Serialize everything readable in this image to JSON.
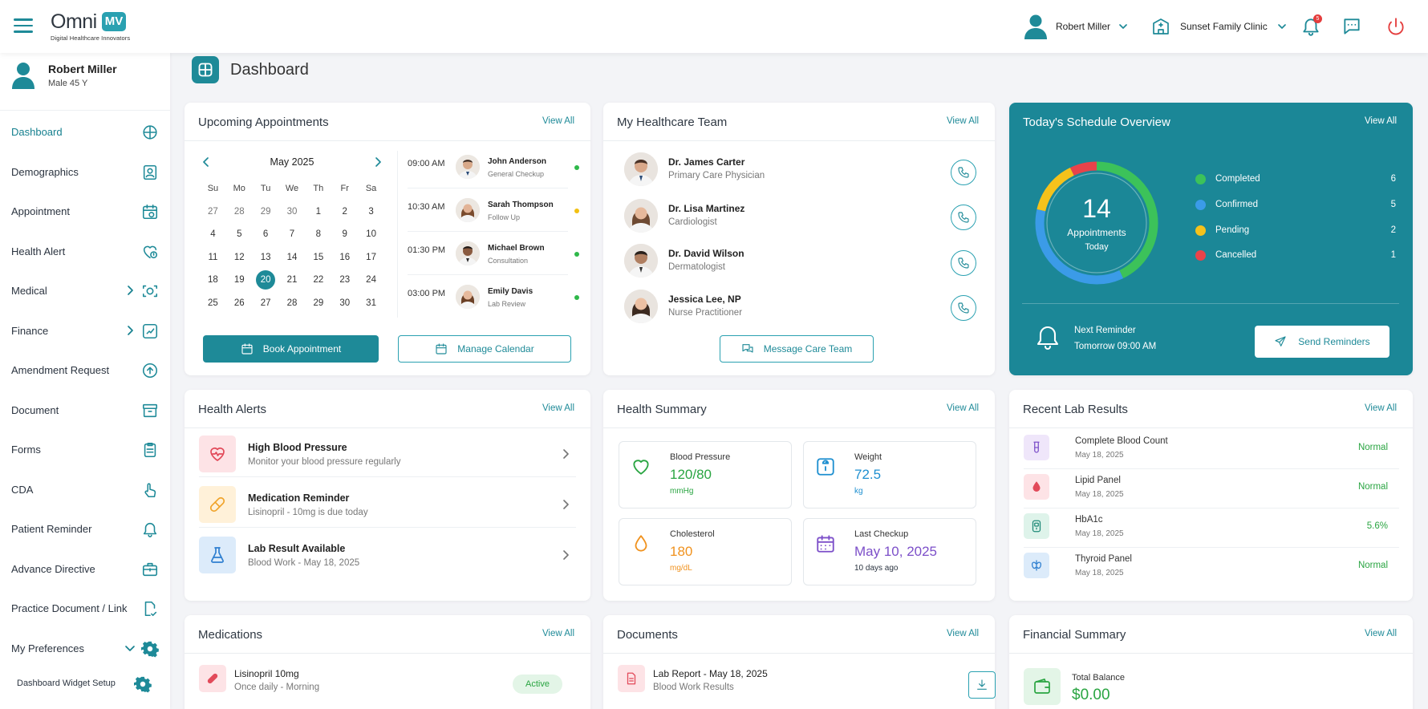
{
  "header": {
    "logo_word": "Omni",
    "logo_mark": "MV",
    "logo_tagline": "Digital Healthcare Innovators",
    "user_name": "Robert Miller",
    "clinic_name": "Sunset Family Clinic",
    "notification_count": "5"
  },
  "sidebar": {
    "profile_name": "Robert Miller",
    "profile_sub": "Male 45 Y",
    "items": [
      {
        "label": "Dashboard",
        "icon": "dashboard-icon"
      },
      {
        "label": "Demographics",
        "icon": "id-card-icon"
      },
      {
        "label": "Appointment",
        "icon": "calendar-icon"
      },
      {
        "label": "Health Alert",
        "icon": "heart-alert-icon"
      },
      {
        "label": "Medical",
        "icon": "eye-scan-icon"
      },
      {
        "label": "Finance",
        "icon": "finance-icon"
      },
      {
        "label": "Amendment Request",
        "icon": "upload-icon"
      },
      {
        "label": "Document",
        "icon": "archive-icon"
      },
      {
        "label": "Forms",
        "icon": "clipboard-icon"
      },
      {
        "label": "CDA",
        "icon": "hand-pointer-icon"
      },
      {
        "label": "Patient Reminder",
        "icon": "bell-icon"
      },
      {
        "label": "Advance Directive",
        "icon": "briefcase-icon"
      },
      {
        "label": "Practice Document / Link",
        "icon": "doc-link-icon"
      },
      {
        "label": "My Preferences",
        "icon": "gear-icon"
      }
    ],
    "widget_setup": "Dashboard Widget Setup"
  },
  "page": {
    "title": "Dashboard"
  },
  "view_all": "View All",
  "appointments": {
    "title": "Upcoming Appointments",
    "month": "May 2025",
    "weekdays": [
      "Su",
      "Mo",
      "Tu",
      "We",
      "Th",
      "Fr",
      "Sa"
    ],
    "days": [
      "27",
      "28",
      "29",
      "30",
      "1",
      "2",
      "3",
      "4",
      "5",
      "6",
      "7",
      "8",
      "9",
      "10",
      "11",
      "12",
      "13",
      "14",
      "15",
      "16",
      "17",
      "18",
      "19",
      "20",
      "21",
      "22",
      "23",
      "24",
      "25",
      "26",
      "27",
      "28",
      "29",
      "30",
      "31"
    ],
    "selected_day": "20",
    "list": [
      {
        "time": "09:00 AM",
        "name": "John Anderson",
        "type": "General Checkup",
        "status_color": "#2fb84a"
      },
      {
        "time": "10:30 AM",
        "name": "Sarah Thompson",
        "type": "Follow Up",
        "status_color": "#f2c012"
      },
      {
        "time": "01:30 PM",
        "name": "Michael Brown",
        "type": "Consultation",
        "status_color": "#2fb84a"
      },
      {
        "time": "03:00 PM",
        "name": "Emily Davis",
        "type": "Lab Review",
        "status_color": "#2fb84a"
      }
    ],
    "book_label": "Book Appointment",
    "manage_label": "Manage Calendar"
  },
  "team": {
    "title": "My Healthcare Team",
    "members": [
      {
        "name": "Dr. James Carter",
        "role": "Primary Care Physician"
      },
      {
        "name": "Dr. Lisa Martinez",
        "role": "Cardiologist"
      },
      {
        "name": "Dr. David Wilson",
        "role": "Dermatologist"
      },
      {
        "name": "Jessica Lee, NP",
        "role": "Nurse Practitioner"
      }
    ],
    "message_label": "Message Care Team"
  },
  "schedule": {
    "title": "Today's Schedule Overview",
    "total": "14",
    "total_label": "Appointments",
    "total_sub": "Today",
    "legend": [
      {
        "label": "Completed",
        "value": 6,
        "color": "#3cc25a"
      },
      {
        "label": "Confirmed",
        "value": 5,
        "color": "#3b9be8"
      },
      {
        "label": "Pending",
        "value": 2,
        "color": "#f5c21b"
      },
      {
        "label": "Cancelled",
        "value": 1,
        "color": "#e8434a"
      }
    ],
    "reminder_title": "Next Reminder",
    "reminder_value": "Tomorrow 09:00 AM",
    "send_label": "Send Reminders"
  },
  "alerts": {
    "title": "Health Alerts",
    "items": [
      {
        "title": "High Blood Pressure",
        "desc": "Monitor your blood pressure regularly"
      },
      {
        "title": "Medication Reminder",
        "desc": "Lisinopril - 10mg is due today"
      },
      {
        "title": "Lab Result Available",
        "desc": "Blood Work - May 18, 2025"
      }
    ]
  },
  "summary": {
    "title": "Health Summary",
    "tiles": [
      {
        "label": "Blood Pressure",
        "value": "120/80",
        "unit": "mmHg",
        "color": "#2aa542"
      },
      {
        "label": "Weight",
        "value": "72.5",
        "unit": "kg",
        "color": "#1e8fd0"
      },
      {
        "label": "Cholesterol",
        "value": "180",
        "unit": "mg/dL",
        "color": "#f0921e"
      },
      {
        "label": "Last Checkup",
        "value": "May 10, 2025",
        "unit": "10 days ago",
        "color": "#7c4fc9"
      }
    ]
  },
  "labs": {
    "title": "Recent Lab Results",
    "items": [
      {
        "name": "Complete Blood Count",
        "date": "May 18, 2025",
        "status": "Normal"
      },
      {
        "name": "Lipid Panel",
        "date": "May 18, 2025",
        "status": "Normal"
      },
      {
        "name": "HbA1c",
        "date": "May 18, 2025",
        "status": "5.6%"
      },
      {
        "name": "Thyroid Panel",
        "date": "May 18, 2025",
        "status": "Normal"
      }
    ]
  },
  "medications": {
    "title": "Medications",
    "name": "Lisinopril 10mg",
    "schedule": "Once daily - Morning",
    "status": "Active"
  },
  "documents": {
    "title": "Documents",
    "name": "Lab Report - May 18, 2025",
    "desc": "Blood Work Results"
  },
  "financial": {
    "title": "Financial Summary",
    "balance_label": "Total Balance",
    "balance_value": "$0.00"
  }
}
